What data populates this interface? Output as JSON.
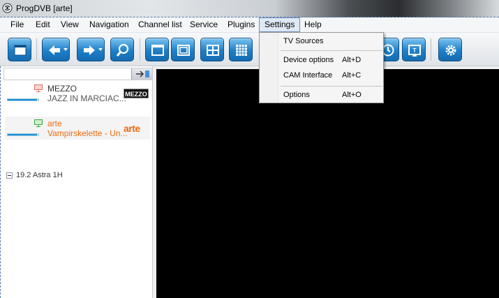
{
  "window": {
    "title": "ProgDVB [arte]",
    "accent": "#1e7fc7"
  },
  "menubar": {
    "items": [
      {
        "label": "File"
      },
      {
        "label": "Edit"
      },
      {
        "label": "View"
      },
      {
        "label": "Navigation"
      },
      {
        "label": "Channel list"
      },
      {
        "label": "Service"
      },
      {
        "label": "Plugins"
      },
      {
        "label": "Settings",
        "open": true
      },
      {
        "label": "Help"
      }
    ]
  },
  "settings_menu": {
    "items": [
      {
        "label": "TV Sources",
        "shortcut": ""
      },
      {
        "label": "Device options",
        "shortcut": "Alt+D"
      },
      {
        "label": "CAM Interface",
        "shortcut": "Alt+C"
      },
      {
        "label": "Options",
        "shortcut": "Alt+O"
      }
    ]
  },
  "toolbar": {
    "buttons": [
      "window-icon",
      "back-icon",
      "forward-icon",
      "search-icon",
      "layout-single-icon",
      "layout-pip-icon",
      "layout-quad-icon",
      "layout-grid-icon",
      "clock-icon",
      "teletext-icon",
      "settings-gear-icon"
    ]
  },
  "channel_list": {
    "search_value": "",
    "channels": [
      {
        "name": "MEZZO",
        "program": "JAZZ IN  MARCIAC...",
        "logo_text": "MEZZO",
        "name_color": "#333333",
        "selected": false,
        "signal": 0.95
      },
      {
        "name": "arte",
        "program": "Vampirskelette - Un...",
        "logo_text": "arte",
        "name_color": "#ef6b12",
        "selected": true,
        "signal": 0.95
      }
    ],
    "group": {
      "label": "19.2 Astra 1H"
    }
  }
}
